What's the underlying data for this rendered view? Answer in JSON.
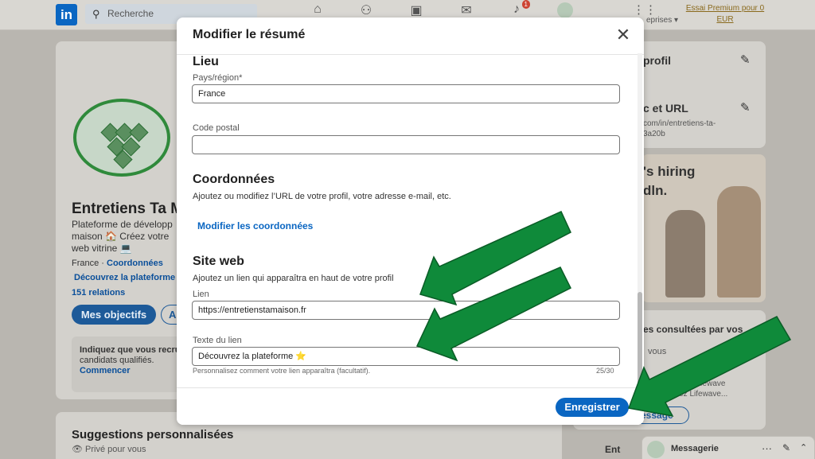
{
  "colors": {
    "accent": "#0a66c2",
    "arrow": "#0f8a3a",
    "logo_green": "#2f8a3b"
  },
  "topbar": {
    "logo": "in",
    "search_placeholder": "Recherche",
    "notification_count": "1",
    "entreprises": "eprises ▾",
    "premium": "Essai Premium pour 0 EUR"
  },
  "background": {
    "name": "Entretiens Ta M",
    "headline_1": "Plateforme de développ",
    "headline_2": "maison 🏠 Créez votre",
    "headline_3": "web vitrine 💻",
    "location": "France · ",
    "contact_link": "Coordonnées",
    "website_link": "Découvrez la plateforme",
    "relations": "151 relations",
    "objectives_button": "Mes objectifs",
    "second_button": "A",
    "recruit_text_1": "Indiquez que vous recru",
    "recruit_text_2": "candidats qualifiés.",
    "recruit_link": "Commencer",
    "suggestions_title": "Suggestions personnalisées",
    "suggestions_sub": "Privé pour vous",
    "right_profil": "profil",
    "right_url_title": "c et URL",
    "right_url_1": "com/in/entretiens-ta-",
    "right_url_2": "3a20b",
    "ad_text_1": "'s hiring",
    "ad_text_2": "dln.",
    "consulted_title": "es consultées par vos",
    "consulted_sub": "vous",
    "right_misc_1": "Lifewave",
    "right_misc_2": "enez Lifewave...",
    "message_button": "essage",
    "messagerie": "Messagerie",
    "bottom_snip": "Ent"
  },
  "modal": {
    "title": "Modifier le résumé",
    "lieu": {
      "title": "Lieu",
      "country_label": "Pays/région*",
      "country_value": "France",
      "postal_label": "Code postal",
      "postal_value": ""
    },
    "coordonnees": {
      "title": "Coordonnées",
      "description": "Ajoutez ou modifiez l’URL de votre profil, votre adresse e-mail, etc.",
      "link": "Modifier les coordonnées"
    },
    "site_web": {
      "title": "Site web",
      "description": "Ajoutez un lien qui apparaîtra en haut de votre profil",
      "link_label": "Lien",
      "link_value": "https://entretienstamaison.fr",
      "text_label": "Texte du lien",
      "text_value": "Découvrez la plateforme ⭐",
      "helper": "Personnalisez comment votre lien apparaîtra (facultatif).",
      "counter": "25/30"
    },
    "save_button": "Enregistrer"
  }
}
